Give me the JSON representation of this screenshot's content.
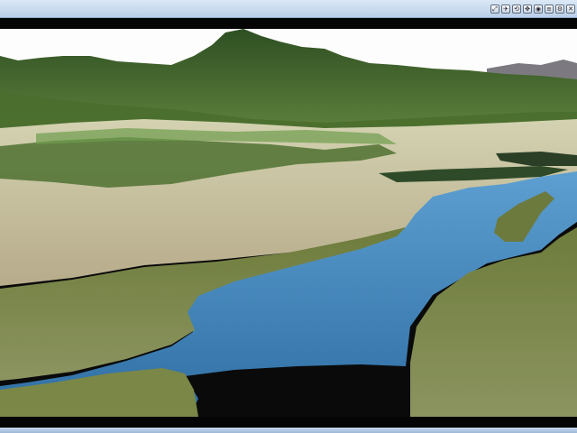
{
  "window": {
    "toolbar_buttons": [
      {
        "id": "zoom-fit",
        "icon": "zoom-fit-icon",
        "glyph": "⤢"
      },
      {
        "id": "fly",
        "icon": "fly-icon",
        "glyph": "✈"
      },
      {
        "id": "orbit",
        "icon": "orbit-icon",
        "glyph": "⟲"
      },
      {
        "id": "pan",
        "icon": "pan-icon",
        "glyph": "✥"
      },
      {
        "id": "capture",
        "icon": "camera-icon",
        "glyph": "◉"
      },
      {
        "id": "layers",
        "icon": "layers-icon",
        "glyph": "≡"
      },
      {
        "id": "settings",
        "icon": "gear-icon",
        "glyph": "⚙"
      },
      {
        "id": "close",
        "icon": "close-icon",
        "glyph": "✕"
      }
    ]
  },
  "scene": {
    "sky_color": "#fdfdfd",
    "mountain_color": "#3f6b2c",
    "water_color": "#3f7fb0",
    "plain_color": "#bfb590",
    "grass_color": "#7c8a49"
  }
}
